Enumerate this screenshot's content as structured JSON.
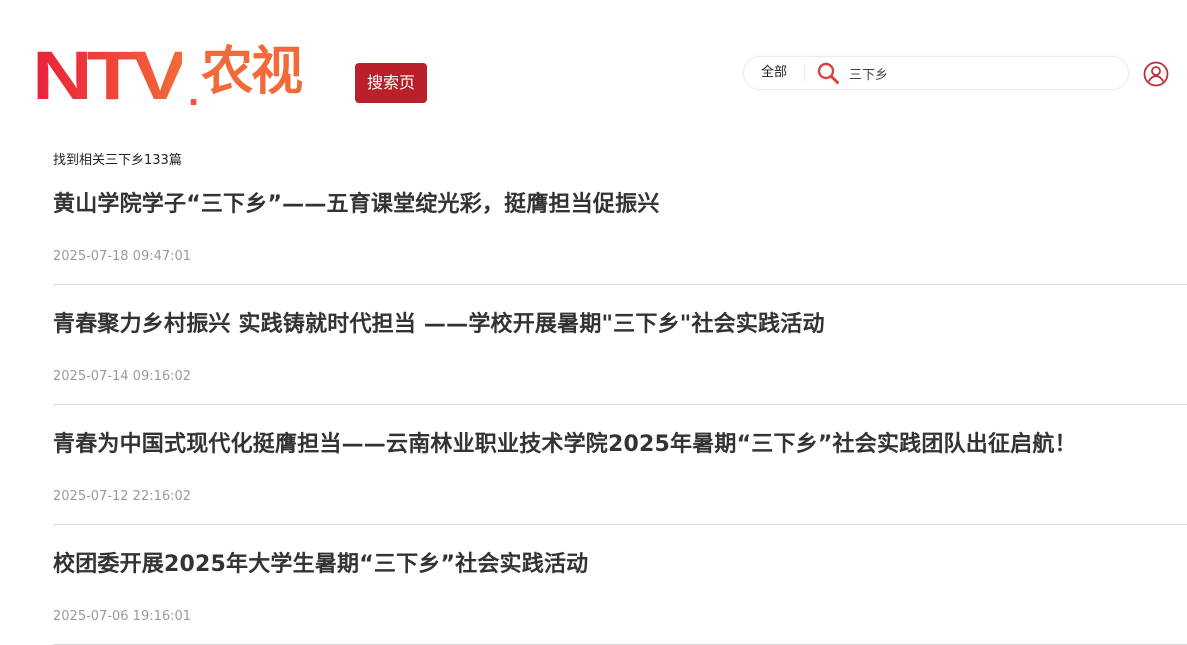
{
  "header": {
    "logo_text": "NTV",
    "logo_dot": ".",
    "logo_cn": "农视",
    "page_tag": "搜索页",
    "brand_colors": [
      "#e8203b",
      "#f26b3a"
    ],
    "accent_color": "#b9202a"
  },
  "search": {
    "scope": "全部",
    "query": "三下乡",
    "icon": "search-icon"
  },
  "user": {
    "icon": "user-icon"
  },
  "results": {
    "summary": "找到相关三下乡133篇",
    "items": [
      {
        "title": "黄山学院学子“三下乡”——五育课堂绽光彩，挺膺担当促振兴",
        "date": "2025-07-18 09:47:01"
      },
      {
        "title": "青春聚力乡村振兴 实践铸就时代担当 ——学校开展暑期\"三下乡\"社会实践活动",
        "date": "2025-07-14 09:16:02"
      },
      {
        "title": "青春为中国式现代化挺膺担当——云南林业职业技术学院2025年暑期“三下乡”社会实践团队出征启航！",
        "date": "2025-07-12 22:16:02"
      },
      {
        "title": "校团委开展2025年大学生暑期“三下乡”社会实践活动",
        "date": "2025-07-06 19:16:01"
      }
    ]
  }
}
